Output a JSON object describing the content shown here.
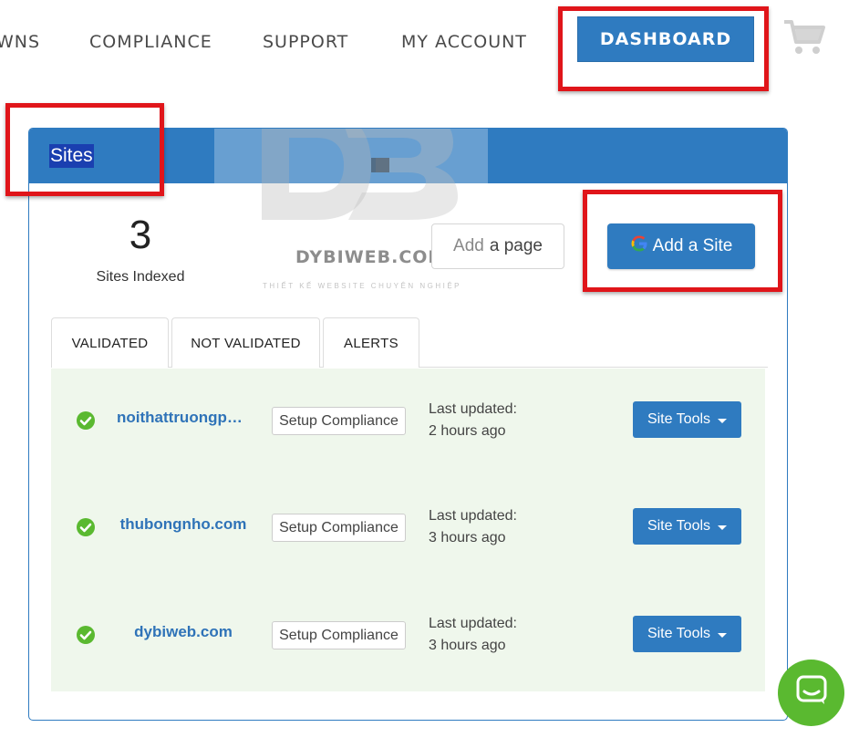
{
  "nav": {
    "items": [
      "WNS",
      "COMPLIANCE",
      "SUPPORT",
      "MY ACCOUNT"
    ],
    "dashboard_label": "DASHBOARD"
  },
  "panel": {
    "title": "Sites",
    "sites_count": "3",
    "sites_count_label": "Sites Indexed",
    "add_page_label_first": "Add",
    "add_page_label_rest": "a page",
    "add_site_label": "Add a Site"
  },
  "watermark": {
    "brand": "DYBIWEB.COM",
    "tagline": "THIẾT KẾ WEBSITE CHUYÊN NGHIỆP"
  },
  "tabs": [
    "VALIDATED",
    "NOT VALIDATED",
    "ALERTS"
  ],
  "sites": [
    {
      "domain": "noithattruongphat.com",
      "setup_label": "Setup Compliance",
      "updated_label": "Last updated:",
      "updated_value": "2 hours ago",
      "tools_label": "Site Tools"
    },
    {
      "domain": "thubongnho.com",
      "setup_label": "Setup Compliance",
      "updated_label": "Last updated:",
      "updated_value": "3 hours ago",
      "tools_label": "Site Tools"
    },
    {
      "domain": "dybiweb.com",
      "setup_label": "Setup Compliance",
      "updated_label": "Last updated:",
      "updated_value": "3 hours ago",
      "tools_label": "Site Tools"
    }
  ],
  "colors": {
    "primary": "#2f7bc0",
    "highlight": "#e0151a",
    "list_background": "#eff7ec",
    "check": "#5ab930",
    "chat": "#5ab930"
  },
  "icons": [
    "cart-icon",
    "google-icon",
    "check-circle-icon",
    "caret-down-icon",
    "chat-icon"
  ]
}
